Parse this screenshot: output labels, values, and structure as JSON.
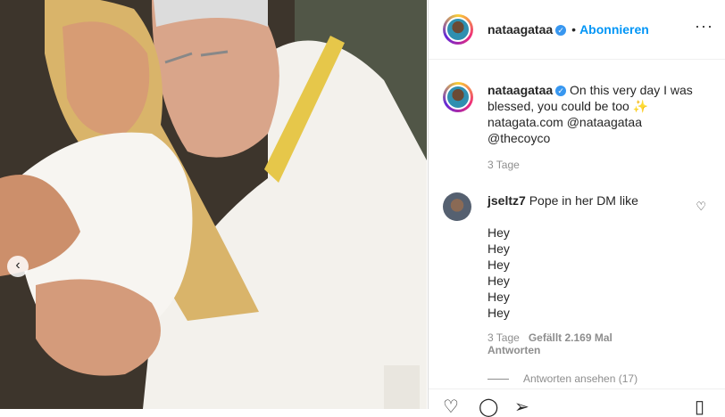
{
  "post": {
    "username": "nataagataa",
    "follow_label": "Abonnieren",
    "caption_lines": [
      "On this very day I was",
      "blessed, you could be too ✨",
      "natagata.com @nataagataa",
      "@thecoyco"
    ],
    "caption_time": "3 Tage"
  },
  "comment": {
    "username": "jseltz7",
    "first_line": "Pope in her DM like",
    "lines": [
      "Hey",
      "Hey",
      "Hey",
      "Hey",
      "Hey",
      "Hey"
    ],
    "time": "3 Tage",
    "likes": "Gefällt 2.169 Mal",
    "reply_label": "Antworten",
    "view_replies": "Antworten ansehen (17)"
  }
}
